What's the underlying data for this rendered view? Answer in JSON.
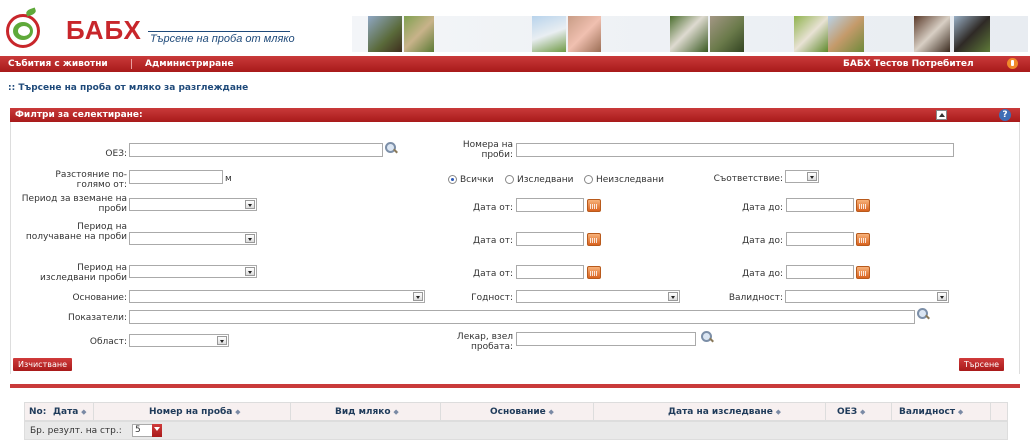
{
  "header": {
    "brand": "БАБХ",
    "subtitle": "Търсене на проба от мляко"
  },
  "menu": {
    "items": [
      {
        "label": "Събития с животни"
      },
      {
        "label": "Администриране"
      }
    ],
    "user": "БАБХ Тестов Потребител"
  },
  "breadcrumb": ":: Търсене на проба от мляко за разглеждане",
  "filter_panel": {
    "title": "Филтри за селектиране:",
    "help": "?",
    "oez_label": "ОЕЗ:",
    "sample_numbers_label": "Номера на проби:",
    "distance_label": "Разстояние по-голямо от:",
    "distance_unit": "м",
    "radio_all": "Всички",
    "radio_tested": "Изследвани",
    "radio_untested": "Неизследвани",
    "radio_selected": "Всички",
    "compliance_label": "Съответствие:",
    "period_sampling_label": "Период за вземане на проби",
    "period_receipt_label": "Период на получаване на проби",
    "period_testing_label": "Период на изследвани проби",
    "date_from_label": "Дата от:",
    "date_to_label": "Дата до:",
    "basis_label": "Основание:",
    "fitness_label": "Годност:",
    "validity_label": "Валидност:",
    "indicators_label": "Показатели:",
    "region_label": "Област:",
    "doctor_label": "Лекар, взел пробата:",
    "clear_button": "Изчистване",
    "search_button": "Търсене"
  },
  "results": {
    "columns": [
      {
        "label": "No:",
        "sortable": false
      },
      {
        "label": "Дата",
        "sortable": true
      },
      {
        "label": "Номер на проба",
        "sortable": true
      },
      {
        "label": "Вид мляко",
        "sortable": true
      },
      {
        "label": "Основание",
        "sortable": true
      },
      {
        "label": "Дата на изследване",
        "sortable": true
      },
      {
        "label": "ОЕЗ",
        "sortable": true
      },
      {
        "label": "Валидност",
        "sortable": true
      }
    ],
    "sort_glyph": "⬥",
    "per_page_label": "Бр. резулт. на стр.:",
    "per_page_value": "5"
  },
  "colors": {
    "accent_red": "#c8262b",
    "nav_blue": "#1f4a7a",
    "logo_green": "#5fa93a"
  },
  "icons": [
    "search-icon",
    "calendar-icon",
    "dropdown-arrow-icon",
    "power-icon",
    "help-icon",
    "collapse-icon"
  ]
}
